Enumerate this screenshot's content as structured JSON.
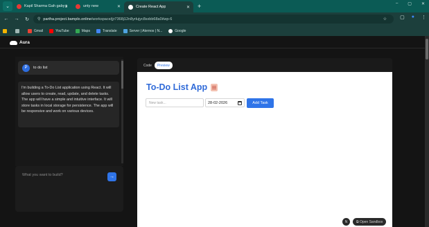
{
  "browser": {
    "tabs": [
      {
        "title": "Kapil Sharma Gah gaby jacasu",
        "favicon_color": "#e53935"
      },
      {
        "title": "unty new",
        "favicon_color": "#e53935"
      },
      {
        "title": "Create React App",
        "favicon_color": "#ffffff"
      }
    ],
    "new_tab_label": "+",
    "window_controls": [
      "–",
      "▢",
      "✕"
    ],
    "address": {
      "host": "partha.project.bamplo.online",
      "path": "/workspace/jjr7368j12n8yrlujyc8sxbb68a0i/wp-6"
    },
    "bookmarks": [
      {
        "label": "Gmail",
        "color": "#ea4335"
      },
      {
        "label": "YouTube",
        "color": "#ff0000"
      },
      {
        "label": "Maps",
        "color": "#34a853"
      },
      {
        "label": "Translate",
        "color": "#4285f4"
      },
      {
        "label": "Server | Aternos | N...",
        "color": "#4fa3e0"
      },
      {
        "label": "Google",
        "color": "#ffffff"
      }
    ]
  },
  "app": {
    "brand": "Aura",
    "prompt": {
      "avatar": "P",
      "text": "to do list"
    },
    "reply": "I'm building a To-Do List application using React. It will allow users to create, read, update, and delete tasks. The app will have a simple and intuitive interface. It will store tasks in local storage for persistence. The app will be responsive and work on various devices.",
    "build_input_placeholder": "What you want to build?",
    "send_icon": "→",
    "tabs": [
      {
        "label": "Code",
        "active": false
      },
      {
        "label": "Preview",
        "active": true
      }
    ],
    "preview": {
      "title": "To-Do List App",
      "task_placeholder": "New task...",
      "date_value": "28-02-2026",
      "add_button": "Add Task"
    },
    "sandbox": {
      "n_label": "N",
      "open_label": "⧉ Open Sandbox"
    }
  }
}
